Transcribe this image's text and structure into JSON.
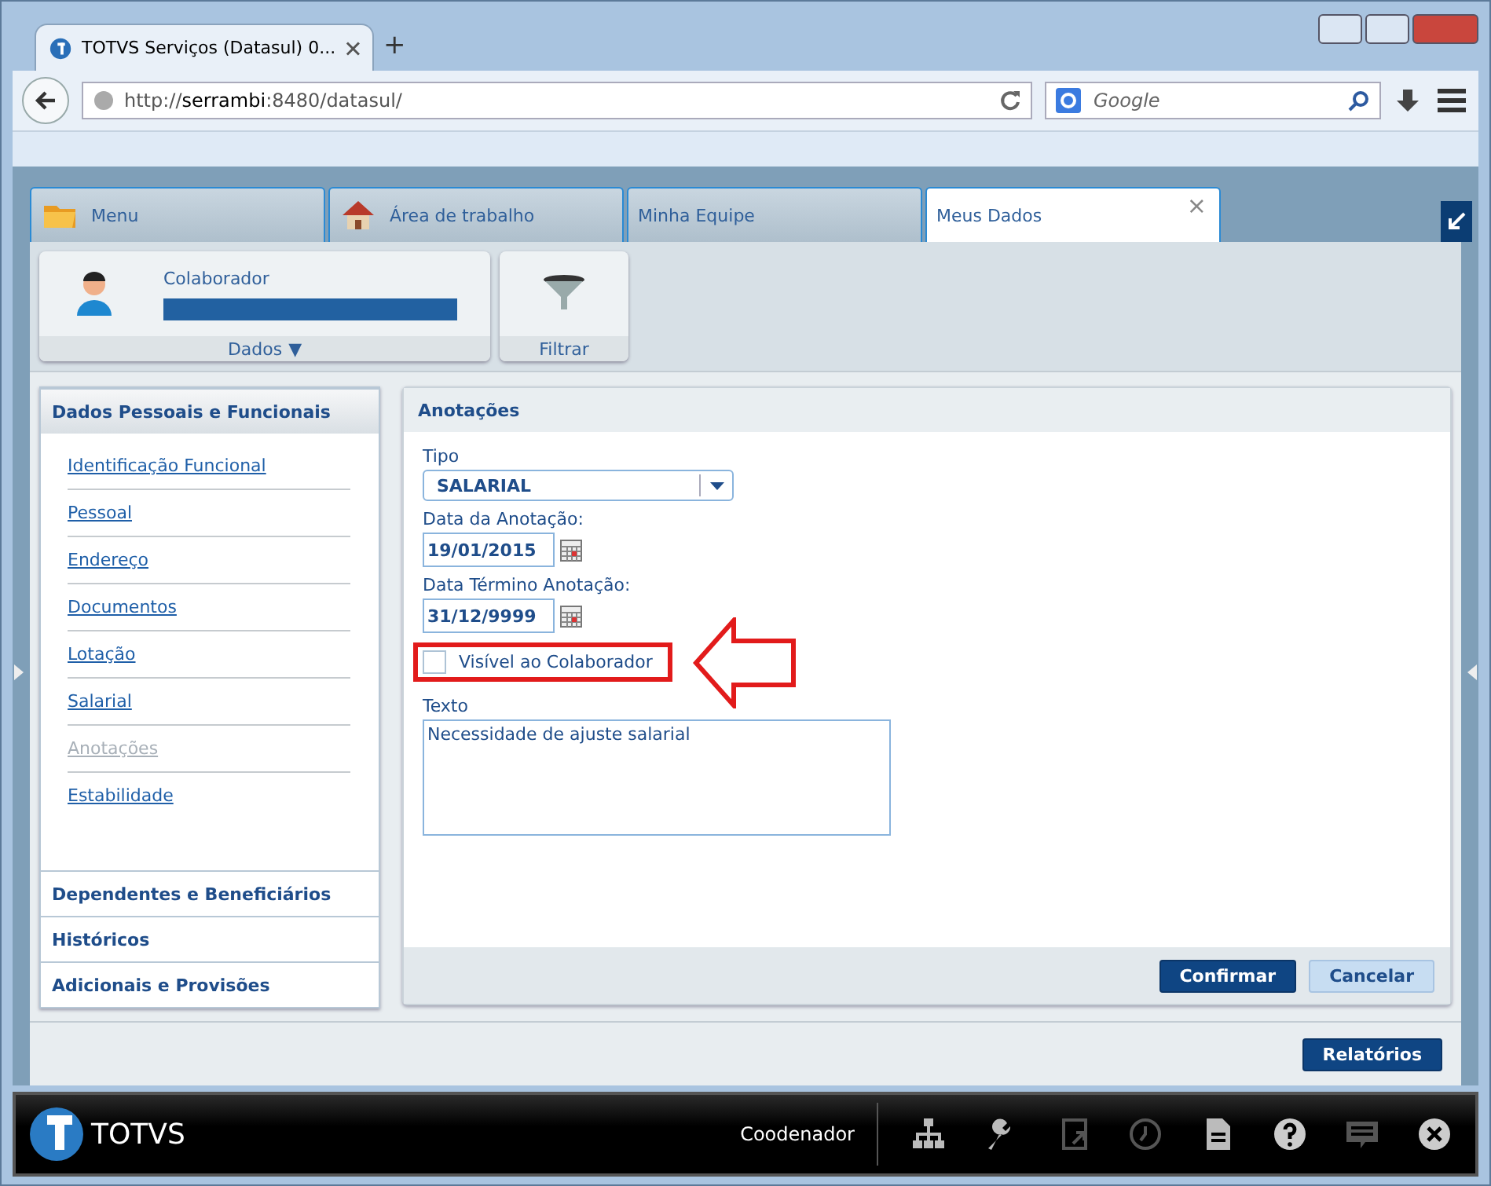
{
  "browser": {
    "tab_title": "TOTVS Serviços (Datasul) 0...",
    "new_tab": "+",
    "url": "http://**serrambi**:8480/datasul/",
    "search_placeholder": "Google"
  },
  "app_tabs": [
    {
      "label": "Menu",
      "kind": "folder",
      "selected": false
    },
    {
      "label": "Área de trabalho",
      "kind": "house",
      "selected": false
    },
    {
      "label": "Minha Equipe",
      "kind": "plain",
      "selected": false
    },
    {
      "label": "Meus Dados",
      "kind": "plain",
      "selected": true,
      "close": "×"
    }
  ],
  "header": {
    "employee_label": "Colaborador",
    "data_menu": "Dados",
    "data_caret": "▼",
    "filter": "Filtrar"
  },
  "sidebar": [
    {
      "title": "Dados Pessoais e Funcionais",
      "expanded": true,
      "items": [
        {
          "label": "Identificação Funcional",
          "selected": false
        },
        {
          "label": "Pessoal",
          "selected": false
        },
        {
          "label": "Endereço",
          "selected": false
        },
        {
          "label": "Documentos",
          "selected": false
        },
        {
          "label": "Lotação",
          "selected": false
        },
        {
          "label": "Salarial",
          "selected": false
        },
        {
          "label": "Anotações",
          "selected": true
        },
        {
          "label": "Estabilidade",
          "selected": false
        }
      ]
    },
    {
      "title": "Dependentes e Beneficiários",
      "expanded": false
    },
    {
      "title": "Históricos",
      "expanded": false
    },
    {
      "title": "Adicionais e Provisões",
      "expanded": false
    }
  ],
  "form": {
    "title": "Anotações",
    "type_label": "Tipo",
    "type_value": "SALARIAL",
    "date_label": "Data da Anotação:",
    "date_value": "19/01/2015",
    "end_label": "Data Término Anotação:",
    "end_value": "31/12/9999",
    "visible_label": "Visível ao Colaborador",
    "visible_checked": false,
    "text_label": "Texto",
    "text_value": "Necessidade de ajuste salarial"
  },
  "form_buttons": [
    {
      "label": "Confirmar",
      "primary": true
    },
    {
      "label": "Cancelar",
      "primary": false
    }
  ],
  "reports_button": "Relatórios",
  "taskbar": {
    "brand": "TOTVS",
    "user": "Coodenador"
  }
}
